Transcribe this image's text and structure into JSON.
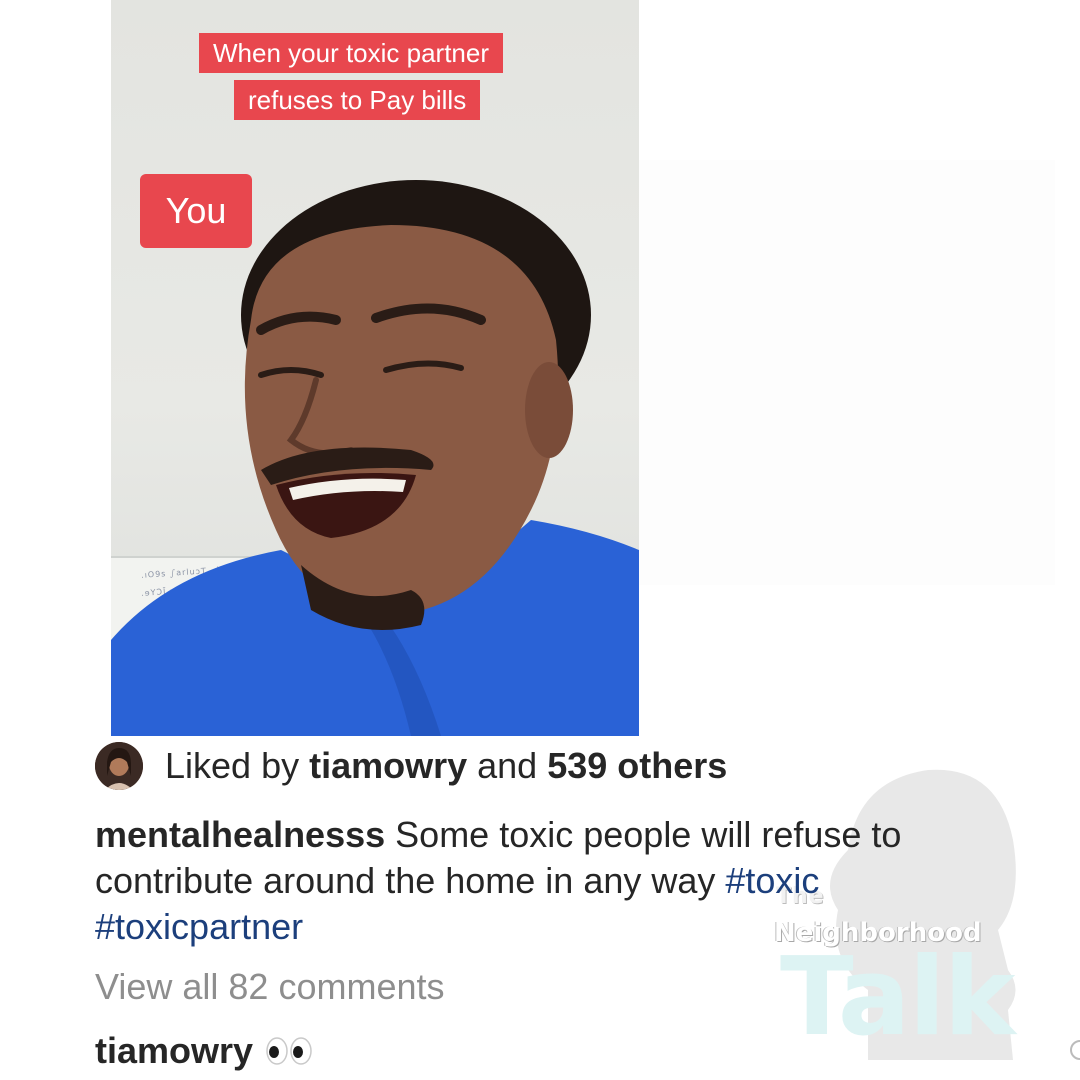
{
  "video": {
    "caption_line1": "When your toxic partner",
    "caption_line2": "refuses to Pay bills",
    "label": "You"
  },
  "post": {
    "liked_prefix": "Liked by ",
    "liked_user": "tiamowry",
    "liked_middle": " and ",
    "liked_count": "539 others",
    "caption_username": "mentalhealnesss",
    "caption_text": " Some toxic people will refuse to contribute around the home in any way ",
    "hashtag1": "#toxic",
    "hashtag2": "#toxicpartner",
    "view_comments": "View all 82 comments",
    "comment_username": "tiamowry",
    "comment_icon": "eyes-emoji"
  },
  "watermark": {
    "line1": "The",
    "line2": "Neighborhood",
    "line3": "Talk"
  },
  "colors": {
    "caption_red": "#e8474e",
    "hashtag_blue": "#1c3f7c",
    "shirt_blue": "#2a62d6"
  }
}
